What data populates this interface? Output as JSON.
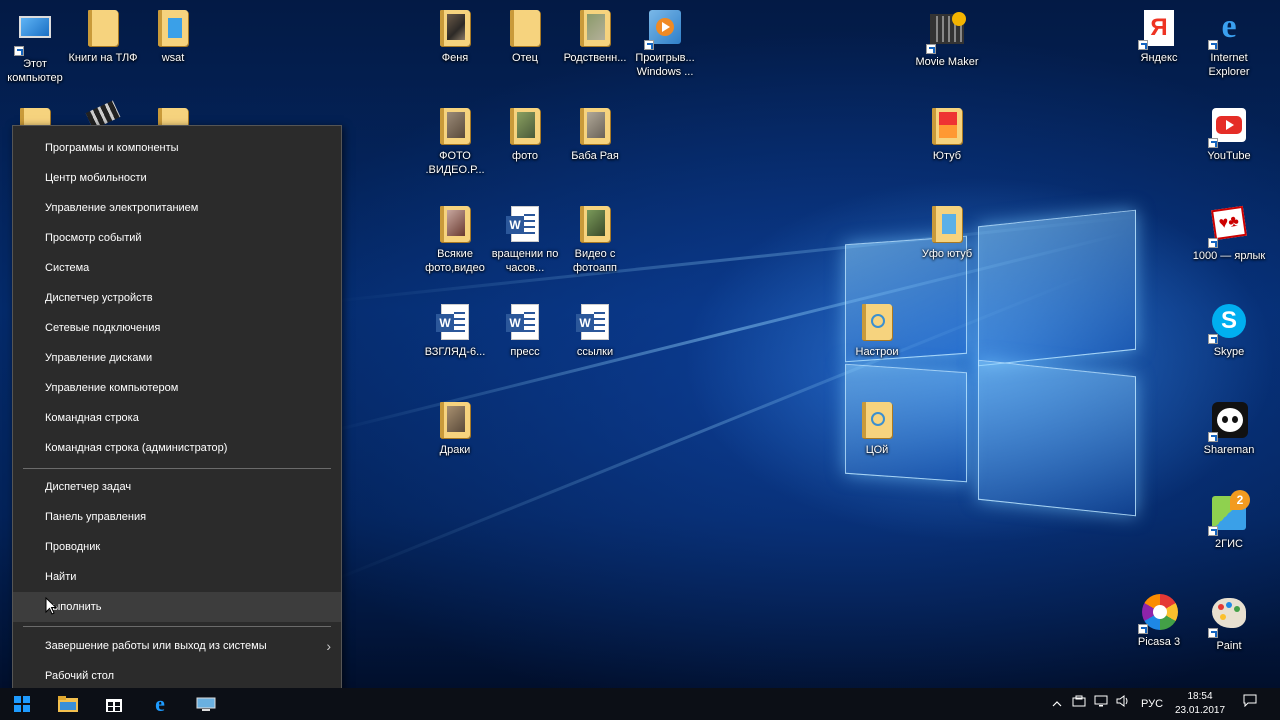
{
  "desktop_icons": {
    "this_pc": "Этот компьютер",
    "books": "Книги на ТЛФ",
    "wsat": "wsat",
    "fenya": "Феня",
    "otec": "Отец",
    "rodstvenn": "Родственн...",
    "player": "Проигрыв... Windows ...",
    "movie_maker": "Movie Maker",
    "yandex": "Яндекс",
    "ie": "Internet Explorer",
    "foto_video": "ФОТО .ВИДЕО.Р...",
    "foto": "фото",
    "baba_raya": "Баба Рая",
    "youtub": "Ютуб",
    "youtube": "YouTube",
    "vsyakie": "Всякие фото,видео",
    "vrascheniya": "вращении по часов...",
    "video_s": "Видео с фотоапп",
    "ufo": "Уфо ютуб",
    "game1000": "1000 — ярлык",
    "vzglyad": "ВЗГЛЯД-6...",
    "press": "пресс",
    "ssylki": "ссылки",
    "nastroi": "Настрои",
    "skype": "Skype",
    "draki": "Драки",
    "coy": "ЦОй",
    "shareman": "Shareman",
    "gis": "2ГИС",
    "picasa": "Picasa 3",
    "paint": "Paint"
  },
  "context_menu": {
    "items": [
      "Программы и компоненты",
      "Центр мобильности",
      "Управление электропитанием",
      "Просмотр событий",
      "Система",
      "Диспетчер устройств",
      "Сетевые подключения",
      "Управление дисками",
      "Управление компьютером",
      "Командная строка",
      "Командная строка (администратор)",
      "Диспетчер задач",
      "Панель управления",
      "Проводник",
      "Найти",
      "Выполнить",
      "Завершение работы или выход из системы",
      "Рабочий стол"
    ],
    "submenu_arrow": "›"
  },
  "taskbar": {
    "language": "РУС",
    "time": "18:54",
    "date": "23.01.2017"
  },
  "icons": {
    "start": "windows-start-icon",
    "explorer": "file-explorer-icon",
    "store": "store-icon",
    "edge": "edge-icon",
    "notifications": "action-center-icon"
  }
}
